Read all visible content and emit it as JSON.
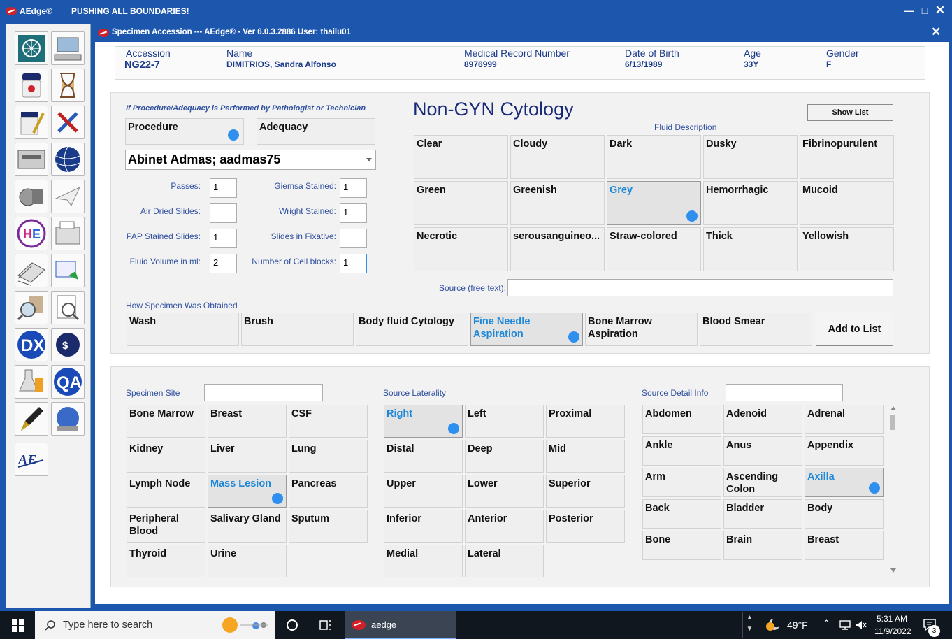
{
  "outer": {
    "app": "AEdge®",
    "slogan": "PUSHING ALL BOUNDARIES!"
  },
  "window": {
    "title": "Specimen Accession --- AEdge® - Ver 6.0.3.2886 User: thailu01"
  },
  "patient": {
    "accession_label": "Accession",
    "accession": "NG22-7",
    "name_label": "Name",
    "name": "DIMITRIOS, Sandra Alfonso",
    "mrn_label": "Medical Record Number",
    "mrn": "8976999",
    "dob_label": "Date of Birth",
    "dob": "6/13/1989",
    "age_label": "Age",
    "age": "33Y",
    "gender_label": "Gender",
    "gender": "F"
  },
  "procedure": {
    "note": "If Procedure/Adequacy is Performed by Pathologist or Technician",
    "procedure_label": "Procedure",
    "adequacy_label": "Adequacy",
    "performer": "Abinet Admas; aadmas75",
    "fields": {
      "passes_label": "Passes:",
      "passes": "1",
      "giemsa_label": "Giemsa Stained:",
      "giemsa": "1",
      "airdried_label": "Air Dried Slides:",
      "airdried": "",
      "wright_label": "Wright Stained:",
      "wright": "1",
      "pap_label": "PAP Stained Slides:",
      "pap": "1",
      "fixative_label": "Slides in Fixative:",
      "fixative": "",
      "volume_label": "Fluid Volume in ml:",
      "volume": "2",
      "cellblocks_label": "Number of Cell blocks:",
      "cellblocks": "1"
    }
  },
  "cytology": {
    "title": "Non-GYN Cytology",
    "show_list": "Show List",
    "fluid_label": "Fluid Description",
    "fluids": [
      "Clear",
      "Cloudy",
      "Dark",
      "Dusky",
      "Fibrinopurulent",
      "Green",
      "Greenish",
      "Grey",
      "Hemorrhagic",
      "Mucoid",
      "Necrotic",
      "serousanguineo...",
      "Straw-colored",
      "Thick",
      "Yellowish"
    ],
    "source_label": "Source (free text):",
    "source": ""
  },
  "obtained": {
    "label": "How Specimen Was Obtained",
    "methods": [
      "Wash",
      "Brush",
      "Body fluid Cytology",
      "Fine Needle Aspiration",
      "Bone Marrow Aspiration",
      "Blood Smear"
    ],
    "add": "Add to List"
  },
  "site": {
    "label": "Specimen Site",
    "value": "",
    "items": [
      "Bone Marrow",
      "Breast",
      "CSF",
      "Kidney",
      "Liver",
      "Lung",
      "Lymph Node",
      "Mass Lesion",
      "Pancreas",
      "Peripheral Blood",
      "Salivary Gland",
      "Sputum",
      "Thyroid",
      "Urine"
    ]
  },
  "laterality": {
    "label": "Source Laterality",
    "items": [
      "Right",
      "Left",
      "Proximal",
      "Distal",
      "Deep",
      "Mid",
      "Upper",
      "Lower",
      "Superior",
      "Inferior",
      "Anterior",
      "Posterior",
      "Medial",
      "Lateral"
    ]
  },
  "detail": {
    "label": "Source Detail Info",
    "value": "",
    "items": [
      "Abdomen",
      "Adenoid",
      "Adrenal",
      "Ankle",
      "Anus",
      "Appendix",
      "Arm",
      "Ascending Colon",
      "Axilla",
      "Back",
      "Bladder",
      "Body",
      "Bone",
      "Brain",
      "Breast"
    ]
  },
  "taskbar": {
    "search": "Type here to search",
    "app": "aedge",
    "temp": "49°F",
    "time": "5:31 AM",
    "date": "11/9/2022",
    "notif": "3"
  },
  "selected": {
    "fluid": "Grey",
    "method": "Fine Needle Aspiration",
    "site": "Mass Lesion",
    "laterality": "Right",
    "detail": "Axilla"
  }
}
